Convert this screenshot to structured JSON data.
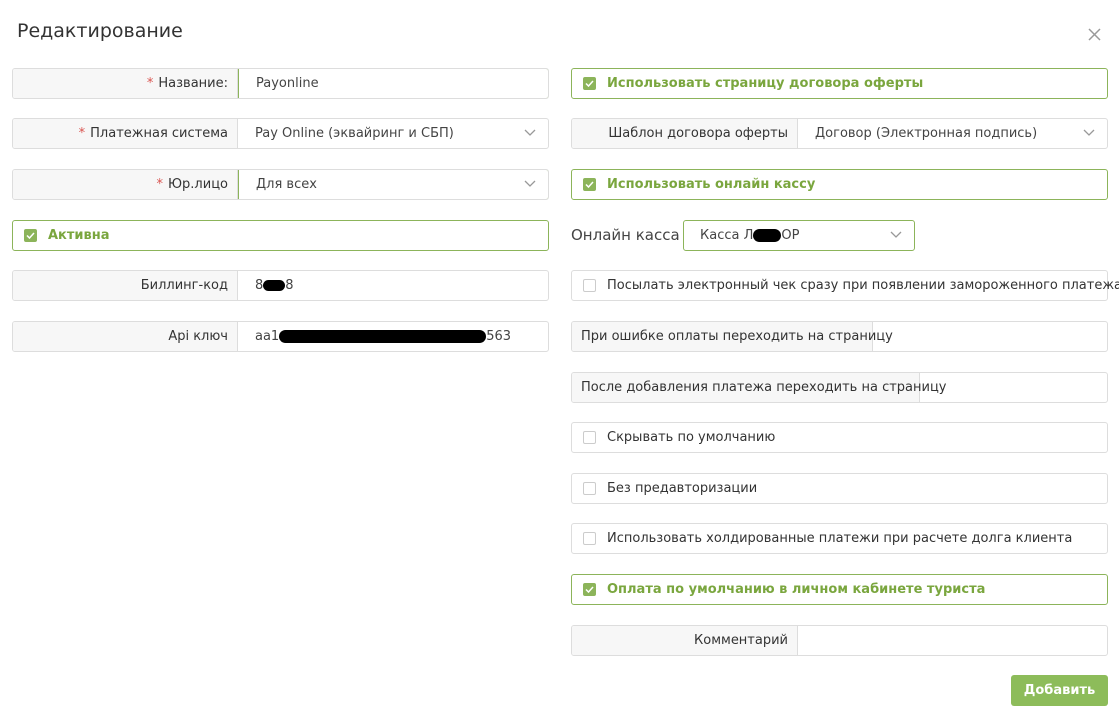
{
  "dialog": {
    "title": "Редактирование"
  },
  "left": {
    "name": {
      "required": "*",
      "label": "Название:",
      "value": "Payonline"
    },
    "payment_system": {
      "required": "*",
      "label": "Платежная система",
      "value": "Pay Online (эквайринг и СБП)"
    },
    "legal_entity": {
      "required": "*",
      "label": "Юр.лицо",
      "value": "Для всех"
    },
    "active": {
      "label": "Активна",
      "checked": true
    },
    "billing_code": {
      "label": "Биллинг-код",
      "value_prefix": "8",
      "value_suffix": "8"
    },
    "api_key": {
      "label": "Api ключ",
      "value_prefix": "aa1",
      "value_suffix": "563"
    }
  },
  "right": {
    "use_offer_page": {
      "label": "Использовать страницу договора оферты",
      "checked": true
    },
    "offer_template": {
      "label": "Шаблон договора оферты",
      "value": "Договор  (Электронная подпись)"
    },
    "use_online_kassa": {
      "label": "Использовать онлайн кассу",
      "checked": true
    },
    "online_kassa": {
      "label": "Онлайн касса",
      "value_prefix": "Касса Л",
      "value_suffix": "ОР"
    },
    "send_receipt": {
      "label": "Посылать электронный чек сразу при появлении замороженного платежа",
      "checked": false
    },
    "error_redirect": {
      "label": "При ошибке оплаты переходить на страницу",
      "value": ""
    },
    "after_add_redirect": {
      "label": "После добавления платежа переходить на страницу",
      "value": ""
    },
    "hide_default": {
      "label": "Скрывать по умолчанию",
      "checked": false
    },
    "no_preauth": {
      "label": "Без предавторизации",
      "checked": false
    },
    "use_hold": {
      "label": "Использовать холдированные платежи при расчете долга клиента",
      "checked": false
    },
    "default_payment": {
      "label": "Оплата по умолчанию в личном кабинете туриста",
      "checked": true
    },
    "comment": {
      "label": "Комментарий",
      "value": ""
    }
  },
  "actions": {
    "submit_label": "Добавить"
  },
  "colors": {
    "accent": "#8cb45a",
    "accent_text": "#7aa63e",
    "required": "#d9534f"
  },
  "icons": {
    "close": "close-icon",
    "chevron": "chevron-down-icon",
    "check": "check-icon"
  }
}
